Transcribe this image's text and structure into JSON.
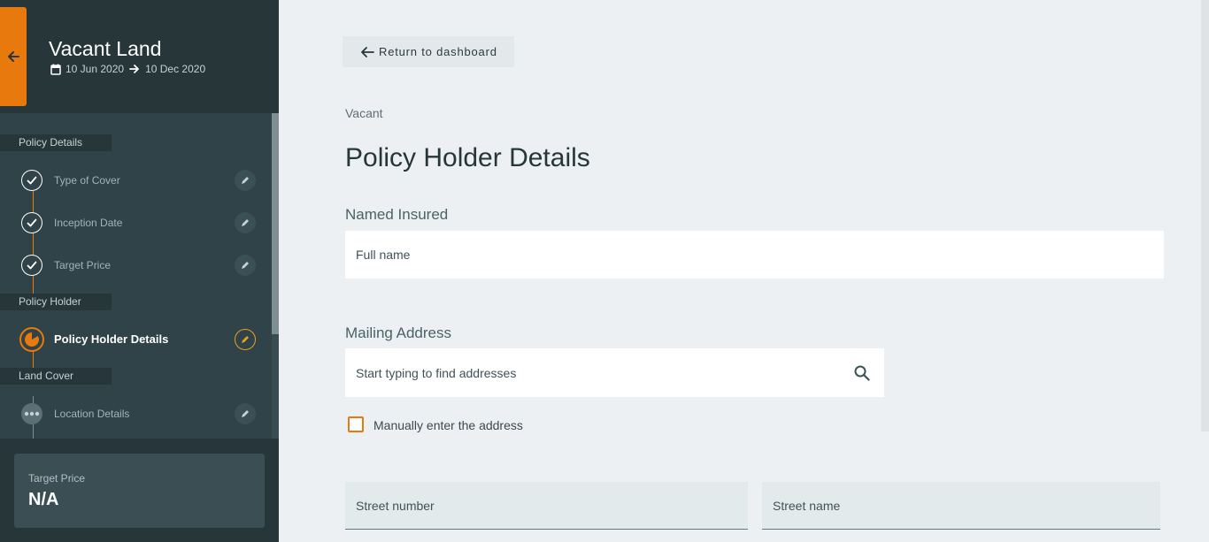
{
  "header": {
    "title": "Vacant Land",
    "date_start": "10 Jun 2020",
    "date_end": "10 Dec 2020"
  },
  "sections": [
    {
      "label": "Policy Details"
    },
    {
      "label": "Policy Holder"
    },
    {
      "label": "Land Cover"
    }
  ],
  "steps": [
    {
      "label": "Type of Cover",
      "status": "done"
    },
    {
      "label": "Inception Date",
      "status": "done"
    },
    {
      "label": "Target Price",
      "status": "done"
    },
    {
      "label": "Policy Holder Details",
      "status": "current"
    },
    {
      "label": "Location Details",
      "status": "pending"
    }
  ],
  "summary": {
    "label": "Target Price",
    "value": "N/A"
  },
  "main": {
    "return_label": "Return to dashboard",
    "breadcrumb": "Vacant",
    "title": "Policy Holder Details",
    "named_insured": {
      "heading": "Named Insured",
      "placeholder": "Full name"
    },
    "mailing_address": {
      "heading": "Mailing Address",
      "search_placeholder": "Start typing to find addresses",
      "manual_label": "Manually enter the address"
    },
    "street_number": "Street number",
    "street_name": "Street name"
  },
  "colors": {
    "accent": "#e8790c",
    "sidebar": "#2f4349",
    "sidebar_dark": "#263639",
    "background": "#ecf0f2"
  }
}
